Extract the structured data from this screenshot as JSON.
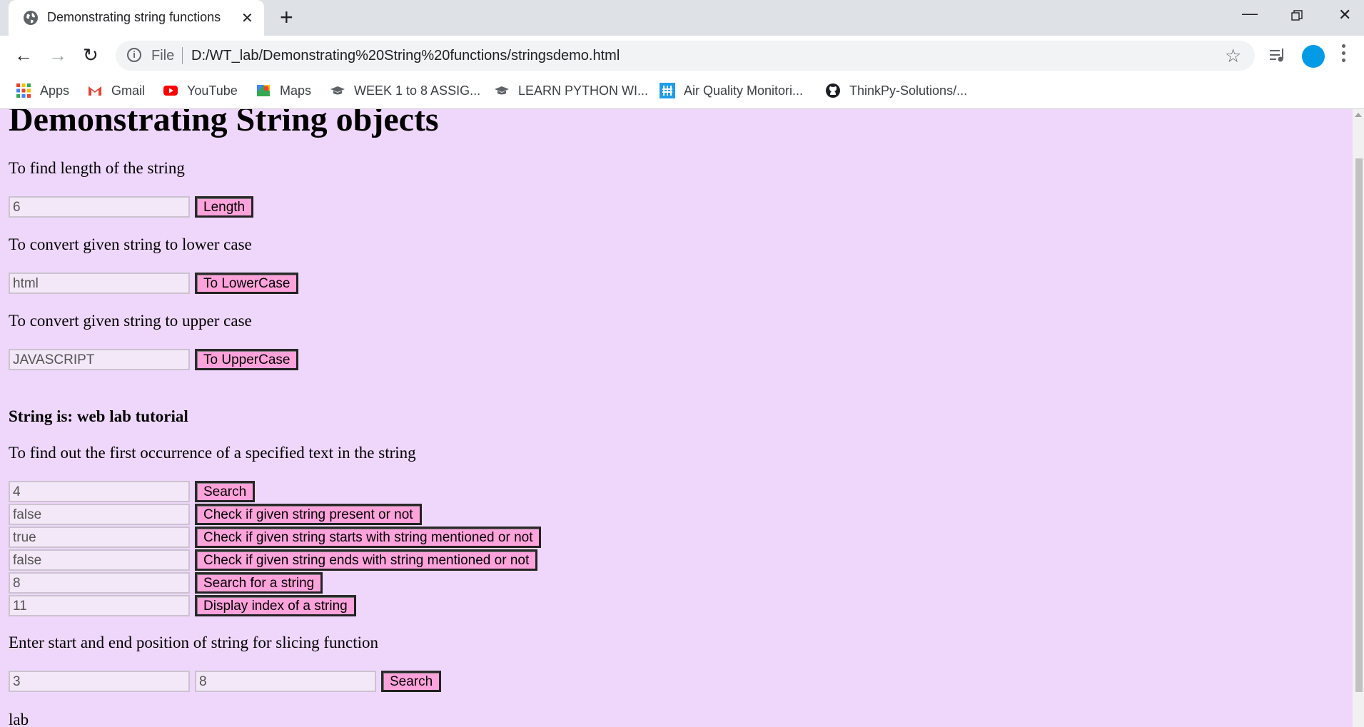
{
  "browser": {
    "tab_title": "Demonstrating string functions",
    "tab_close": "✕",
    "new_tab": "+",
    "url_scheme": "File",
    "url": "D:/WT_lab/Demonstrating%20String%20functions/stringsdemo.html",
    "bookmarks": [
      {
        "label": "Apps",
        "icon": "apps-grid-icon"
      },
      {
        "label": "Gmail",
        "icon": "gmail-icon"
      },
      {
        "label": "YouTube",
        "icon": "youtube-icon"
      },
      {
        "label": "Maps",
        "icon": "maps-icon"
      },
      {
        "label": "WEEK 1 to 8 ASSIG...",
        "icon": "graduation-cap-icon"
      },
      {
        "label": "LEARN PYTHON WI...",
        "icon": "graduation-cap-icon"
      },
      {
        "label": "Air Quality Monitori...",
        "icon": "hackster-icon"
      },
      {
        "label": "ThinkPy-Solutions/...",
        "icon": "github-icon"
      }
    ]
  },
  "page": {
    "heading": "Demonstrating String objects",
    "length_section": {
      "label": "To find length of the string",
      "value": "6",
      "button": "Length"
    },
    "lower_section": {
      "label": "To convert given string to lower case",
      "value": "html",
      "button": "To LowerCase"
    },
    "upper_section": {
      "label": "To convert given string to upper case",
      "value": "JAVASCRIPT",
      "button": "To UpperCase"
    },
    "string_is": "String is: web lab tutorial",
    "occurrence_label": "To find out the first occurrence of a specified text in the string",
    "rows": [
      {
        "value": "4",
        "button": "Search"
      },
      {
        "value": "false",
        "button": "Check if given string present or not"
      },
      {
        "value": "true",
        "button": "Check if given string starts with string mentioned or not"
      },
      {
        "value": "false",
        "button": "Check if given string ends with string mentioned or not"
      },
      {
        "value": "8",
        "button": "Search for a string"
      },
      {
        "value": "11",
        "button": "Display index of a string"
      }
    ],
    "slice_section": {
      "label": "Enter start and end position of string for slicing function",
      "start": "3",
      "end": "8",
      "button": "Search"
    },
    "slice_result": "lab"
  }
}
